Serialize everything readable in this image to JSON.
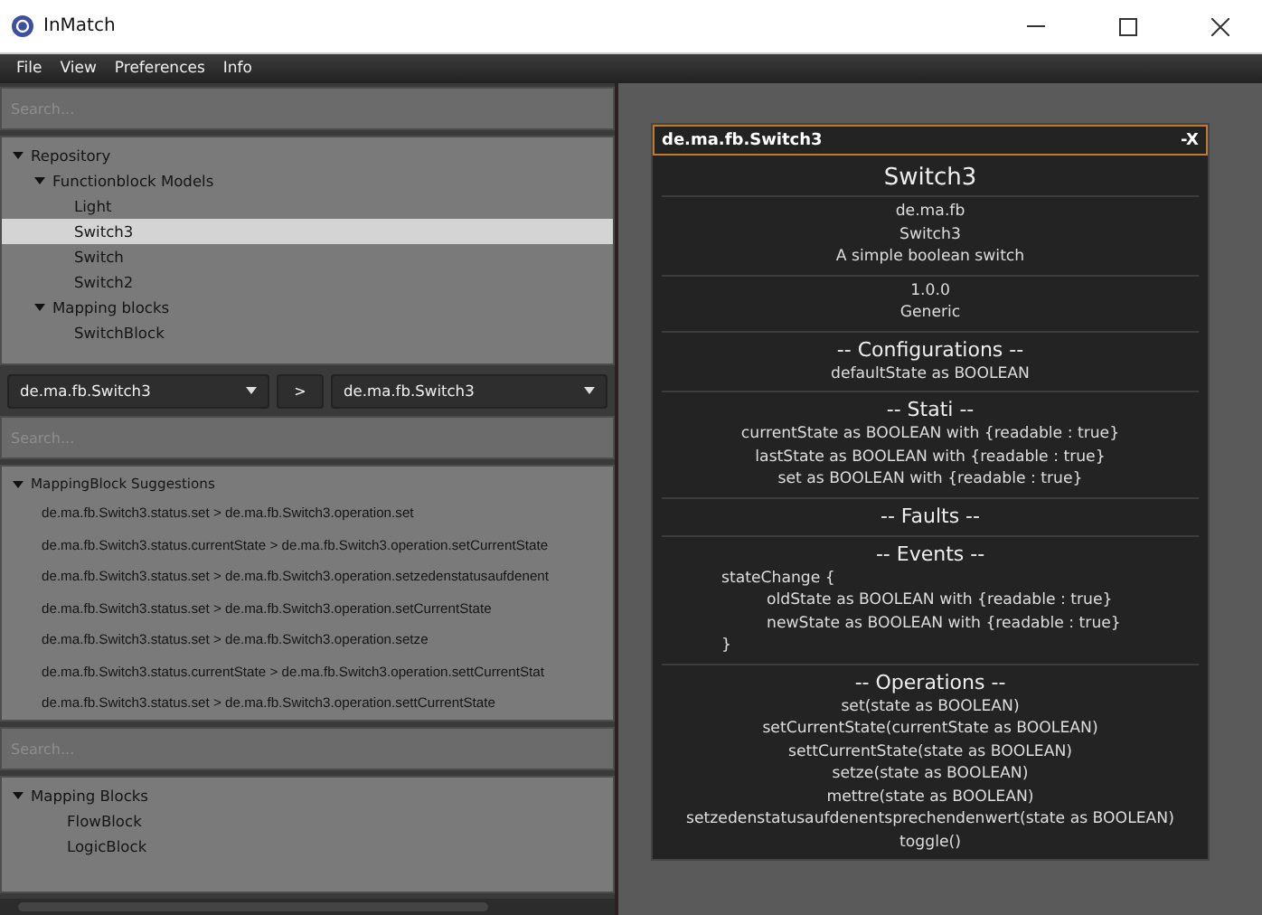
{
  "window": {
    "title": "InMatch"
  },
  "menu": [
    "File",
    "View",
    "Preferences",
    "Info"
  ],
  "repository_search": {
    "placeholder": "Search..."
  },
  "repository_tree": [
    {
      "label": "Repository",
      "expanded": true,
      "selected": false,
      "children": [
        {
          "label": "Functionblock Models",
          "expanded": true,
          "selected": false,
          "children": [
            {
              "label": "Light",
              "selected": false
            },
            {
              "label": "Switch3",
              "selected": true
            },
            {
              "label": "Switch",
              "selected": false
            },
            {
              "label": "Switch2",
              "selected": false
            }
          ]
        },
        {
          "label": "Mapping blocks",
          "expanded": true,
          "selected": false,
          "children": [
            {
              "label": "SwitchBlock",
              "selected": false
            }
          ]
        }
      ]
    }
  ],
  "mapping_selector": {
    "source": "de.ma.fb.Switch3",
    "arrow": ">",
    "target": "de.ma.fb.Switch3"
  },
  "suggestion_search": {
    "placeholder": "Search..."
  },
  "suggestions": {
    "label": "MappingBlock Suggestions",
    "expanded": true,
    "items": [
      "de.ma.fb.Switch3.status.set > de.ma.fb.Switch3.operation.set",
      "de.ma.fb.Switch3.status.currentState > de.ma.fb.Switch3.operation.setCurrentState",
      "de.ma.fb.Switch3.status.set > de.ma.fb.Switch3.operation.setzedenstatusaufdenent",
      "de.ma.fb.Switch3.status.set > de.ma.fb.Switch3.operation.setCurrentState",
      "de.ma.fb.Switch3.status.set > de.ma.fb.Switch3.operation.setze",
      "de.ma.fb.Switch3.status.currentState > de.ma.fb.Switch3.operation.settCurrentStat",
      "de.ma.fb.Switch3.status.set > de.ma.fb.Switch3.operation.settCurrentState"
    ]
  },
  "blocks_search": {
    "placeholder": "Search..."
  },
  "mapping_blocks": {
    "label": "Mapping Blocks",
    "expanded": true,
    "items": [
      "FlowBlock",
      "LogicBlock"
    ]
  },
  "card": {
    "title": "de.ma.fb.Switch3",
    "close": "-X",
    "name": "Switch3",
    "sections": [
      {
        "lines": [
          {
            "text": "de.ma.fb",
            "kind": "center"
          },
          {
            "text": "Switch3",
            "kind": "center"
          },
          {
            "text": "A simple boolean switch",
            "kind": "center"
          }
        ]
      },
      {
        "lines": [
          {
            "text": "1.0.0",
            "kind": "center"
          },
          {
            "text": "Generic",
            "kind": "center"
          }
        ]
      },
      {
        "heading": "-- Configurations --",
        "lines": [
          {
            "text": "defaultState as BOOLEAN",
            "kind": "center"
          }
        ]
      },
      {
        "heading": "-- Stati --",
        "lines": [
          {
            "text": "currentState as BOOLEAN with {readable : true}",
            "kind": "center"
          },
          {
            "text": "lastState as BOOLEAN with {readable : true}",
            "kind": "center"
          },
          {
            "text": "set as BOOLEAN with {readable : true}",
            "kind": "center"
          }
        ]
      },
      {
        "heading": "-- Faults --"
      },
      {
        "heading": "-- Events --",
        "lines": [
          {
            "text": "stateChange {",
            "kind": "code"
          },
          {
            "text": "oldState as BOOLEAN with {readable : true}",
            "kind": "indent"
          },
          {
            "text": "newState as BOOLEAN with {readable : true}",
            "kind": "indent"
          },
          {
            "text": "}",
            "kind": "code"
          }
        ]
      },
      {
        "heading": "-- Operations --",
        "lines": [
          {
            "text": "set(state as BOOLEAN)",
            "kind": "center"
          },
          {
            "text": "setCurrentState(currentState as BOOLEAN)",
            "kind": "center"
          },
          {
            "text": "settCurrentState(state as BOOLEAN)",
            "kind": "center"
          },
          {
            "text": "setze(state as BOOLEAN)",
            "kind": "center"
          },
          {
            "text": "mettre(state as BOOLEAN)",
            "kind": "center"
          },
          {
            "text": "setzedenstatusaufdenentsprechendenwert(state as BOOLEAN)",
            "kind": "center"
          },
          {
            "text": "toggle()",
            "kind": "center"
          }
        ]
      }
    ]
  }
}
